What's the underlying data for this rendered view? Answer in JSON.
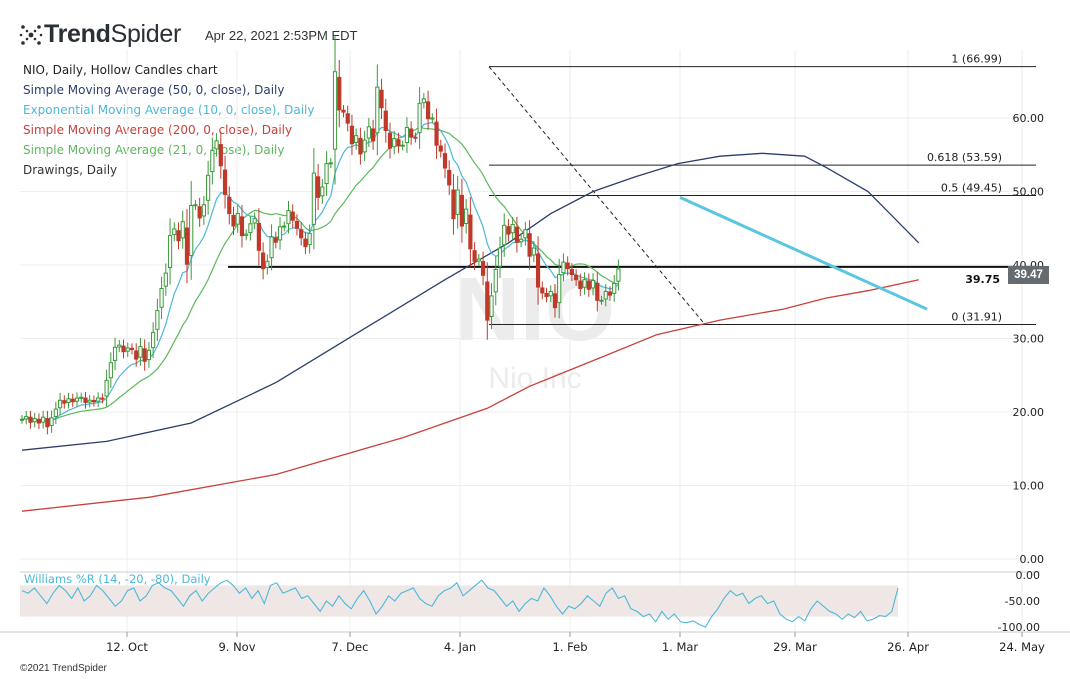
{
  "header": {
    "logo_text_bold": "Trend",
    "logo_text_light": "Spider",
    "timestamp": "Apr 22, 2021 2:53PM EDT",
    "copyright": "©2021 TrendSpider"
  },
  "legend": [
    {
      "label": "NIO, Daily, Hollow Candles chart",
      "color": "#222222"
    },
    {
      "label": "Simple Moving Average (50, 0, close), Daily",
      "color": "#2b3e6b"
    },
    {
      "label": "Exponential Moving Average (10, 0, close), Daily",
      "color": "#4db8d8"
    },
    {
      "label": "Simple Moving Average (200, 0, close), Daily",
      "color": "#c8413b"
    },
    {
      "label": "Simple Moving Average (21, 0, close), Daily",
      "color": "#5cb85c"
    },
    {
      "label": "Drawings, Daily",
      "color": "#333333"
    }
  ],
  "watermark": {
    "symbol": "NIO",
    "name": "Nio Inc"
  },
  "chart_data": {
    "type": "candlestick",
    "title": "NIO, Daily, Hollow Candles chart",
    "ylim": [
      0,
      70
    ],
    "y_ticks": [
      "0.00",
      "10.00",
      "20.00",
      "30.00",
      "40.00",
      "50.00",
      "60.00"
    ],
    "x_ticks": [
      "12. Oct",
      "9. Nov",
      "7. Dec",
      "4. Jan",
      "1. Feb",
      "1. Mar",
      "29. Mar",
      "26. Apr",
      "24. May"
    ],
    "current_price": "39.47",
    "support_level": {
      "label": "39.75",
      "value": 39.75
    },
    "fibonacci": [
      {
        "label": "1 (66.99)",
        "value": 66.99
      },
      {
        "label": "0.618 (53.59)",
        "value": 53.59
      },
      {
        "label": "0.5 (49.45)",
        "value": 49.45
      },
      {
        "label": "0 (31.91)",
        "value": 31.91
      }
    ],
    "closes": [
      19.0,
      19.4,
      18.6,
      19.1,
      18.5,
      19.3,
      18.0,
      19.2,
      20.4,
      21.6,
      21.2,
      21.8,
      21.4,
      21.9,
      22.0,
      21.3,
      21.6,
      21.4,
      21.9,
      21.8,
      24.3,
      26.7,
      28.8,
      29.1,
      28.2,
      28.7,
      28.5,
      27.2,
      28.9,
      26.9,
      28.4,
      30.8,
      33.8,
      36.8,
      38.9,
      44.0,
      44.9,
      43.3,
      45.9,
      40.1,
      48.1,
      48.2,
      46.4,
      48.2,
      52.2,
      55.6,
      56.9,
      53.5,
      49.6,
      47.0,
      45.3,
      47.0,
      44.0,
      44.2,
      45.6,
      46.3,
      42.0,
      39.5,
      40.5,
      43.8,
      43.1,
      45.2,
      45.3,
      47.4,
      46.1,
      45.0,
      43.7,
      42.5,
      44.3,
      52.5,
      49.2,
      50.6,
      53.8,
      53.9,
      66.3,
      61.1,
      60.8,
      59.3,
      56.5,
      57.6,
      55.1,
      57.0,
      58.8,
      56.9,
      64.2,
      61.4,
      58.3,
      55.9,
      57.2,
      56.2,
      56.3,
      58.7,
      57.4,
      57.3,
      62.0,
      62.6,
      59.9,
      60.0,
      56.3,
      55.5,
      53.2,
      50.9,
      46.3,
      50.2,
      45.3,
      47.6,
      42.2,
      40.5,
      40.8,
      38.6,
      32.5,
      35.8,
      39.4,
      42.3,
      45.4,
      44.2,
      45.5,
      43.1,
      43.5,
      44.8,
      41.2,
      42.3,
      37.0,
      36.2,
      35.7,
      36.4,
      34.2,
      38.7,
      40.4,
      39.5,
      38.7,
      38.0,
      36.8,
      38.0,
      36.7,
      37.9,
      35.2,
      35.2,
      36.4,
      35.9,
      37.5,
      39.47
    ],
    "sma50_points": [
      [
        0,
        14.8
      ],
      [
        20,
        16.0
      ],
      [
        40,
        18.5
      ],
      [
        60,
        24.0
      ],
      [
        80,
        31.0
      ],
      [
        100,
        38.0
      ],
      [
        115,
        43.0
      ],
      [
        125,
        47.0
      ],
      [
        135,
        50.0
      ],
      [
        145,
        52.0
      ],
      [
        155,
        53.8
      ],
      [
        165,
        54.8
      ],
      [
        175,
        55.2
      ],
      [
        185,
        54.8
      ],
      [
        190,
        53.3
      ],
      [
        200,
        50.0
      ],
      [
        212,
        43.0
      ]
    ],
    "sma200_points": [
      [
        0,
        6.5
      ],
      [
        30,
        8.4
      ],
      [
        60,
        11.5
      ],
      [
        90,
        16.5
      ],
      [
        110,
        20.5
      ],
      [
        120,
        23.5
      ],
      [
        135,
        27.0
      ],
      [
        150,
        30.5
      ],
      [
        165,
        32.5
      ],
      [
        180,
        34.0
      ],
      [
        190,
        35.5
      ],
      [
        200,
        36.5
      ],
      [
        212,
        38.0
      ]
    ],
    "williams_r": {
      "label": "Williams %R (14, -20, -80), Daily",
      "ylim": [
        -100,
        0
      ],
      "y_ticks": [
        "0.00",
        "-50.00",
        "-100.00"
      ],
      "values": [
        -30,
        -35,
        -25,
        -40,
        -55,
        -35,
        -20,
        -30,
        -45,
        -25,
        -50,
        -40,
        -20,
        -30,
        -45,
        -60,
        -50,
        -30,
        -25,
        -50,
        -40,
        -20,
        -15,
        -25,
        -30,
        -45,
        -60,
        -40,
        -30,
        -50,
        -35,
        -25,
        -15,
        -10,
        -20,
        -35,
        -25,
        -45,
        -30,
        -55,
        -20,
        -15,
        -35,
        -30,
        -25,
        -45,
        -40,
        -55,
        -70,
        -50,
        -60,
        -40,
        -55,
        -65,
        -45,
        -30,
        -50,
        -75,
        -60,
        -40,
        -50,
        -35,
        -30,
        -25,
        -45,
        -55,
        -60,
        -40,
        -30,
        -25,
        -15,
        -40,
        -30,
        -20,
        -10,
        -25,
        -30,
        -45,
        -60,
        -50,
        -70,
        -55,
        -45,
        -50,
        -25,
        -40,
        -60,
        -75,
        -60,
        -65,
        -55,
        -40,
        -50,
        -60,
        -35,
        -25,
        -45,
        -40,
        -65,
        -70,
        -80,
        -75,
        -90,
        -70,
        -85,
        -75,
        -90,
        -92,
        -88,
        -95,
        -100,
        -80,
        -65,
        -45,
        -30,
        -40,
        -35,
        -55,
        -45,
        -40,
        -55,
        -50,
        -75,
        -85,
        -90,
        -80,
        -88,
        -65,
        -50,
        -60,
        -70,
        -75,
        -85,
        -75,
        -82,
        -70,
        -88,
        -85,
        -78,
        -80,
        -70,
        -25
      ]
    }
  }
}
